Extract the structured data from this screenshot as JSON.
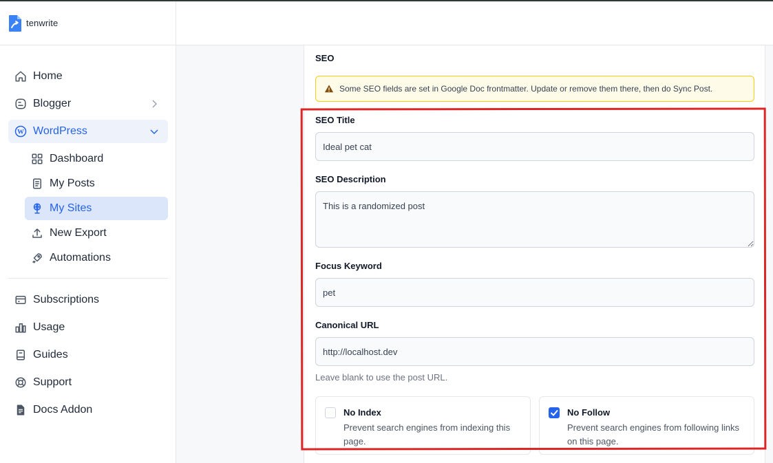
{
  "brand": {
    "name": "tenwrite"
  },
  "sidebar": {
    "items": [
      {
        "label": "Home",
        "icon": "home-icon"
      },
      {
        "label": "Blogger",
        "icon": "blogger-icon"
      },
      {
        "label": "WordPress",
        "icon": "wordpress-icon"
      }
    ],
    "wordpress_sub": [
      {
        "label": "Dashboard",
        "icon": "dashboard-icon"
      },
      {
        "label": "My Posts",
        "icon": "document-icon"
      },
      {
        "label": "My Sites",
        "icon": "globe-icon"
      },
      {
        "label": "New Export",
        "icon": "upload-icon"
      },
      {
        "label": "Automations",
        "icon": "rocket-icon"
      }
    ],
    "bottom": [
      {
        "label": "Subscriptions",
        "icon": "card-icon"
      },
      {
        "label": "Usage",
        "icon": "bar-chart-icon"
      },
      {
        "label": "Guides",
        "icon": "book-icon"
      },
      {
        "label": "Support",
        "icon": "lifebuoy-icon"
      },
      {
        "label": "Docs Addon",
        "icon": "file-icon"
      }
    ]
  },
  "seo": {
    "section_title": "SEO",
    "alert": "Some SEO fields are set in Google Doc frontmatter. Update or remove them there, then do Sync Post.",
    "title_label": "SEO Title",
    "title_value": "Ideal pet cat",
    "description_label": "SEO Description",
    "description_value": "This is a randomized post",
    "keyword_label": "Focus Keyword",
    "keyword_value": "pet",
    "canonical_label": "Canonical URL",
    "canonical_value": "http://localhost.dev",
    "canonical_hint": "Leave blank to use the post URL.",
    "no_index": {
      "title": "No Index",
      "desc": "Prevent search engines from indexing this page.",
      "checked": false
    },
    "no_follow": {
      "title": "No Follow",
      "desc": "Prevent search engines from following links on this page.",
      "checked": true
    }
  },
  "colors": {
    "accent": "#2563eb",
    "highlight": "#dc2626",
    "alert_bg": "#fefce8",
    "alert_border": "#facc15"
  }
}
